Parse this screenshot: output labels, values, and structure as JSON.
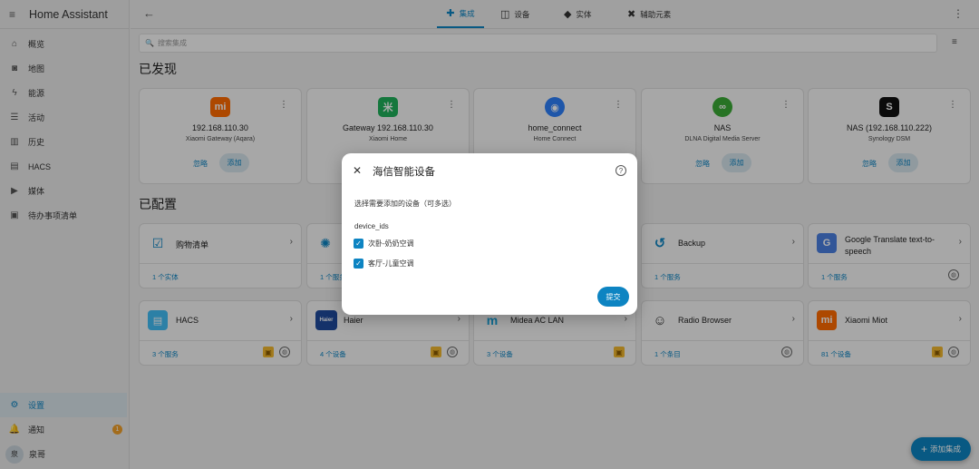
{
  "sidebar": {
    "title": "Home Assistant",
    "items": [
      {
        "label": "概览",
        "icon": "home-icon",
        "glyph": "⌂"
      },
      {
        "label": "地图",
        "icon": "map-icon",
        "glyph": "◙"
      },
      {
        "label": "能源",
        "icon": "lightning-icon",
        "glyph": "ϟ"
      },
      {
        "label": "活动",
        "icon": "list-icon",
        "glyph": "☰"
      },
      {
        "label": "历史",
        "icon": "chart-icon",
        "glyph": "▥"
      },
      {
        "label": "HACS",
        "icon": "hacs-icon",
        "glyph": "▤"
      },
      {
        "label": "媒体",
        "icon": "media-icon",
        "glyph": "▶"
      },
      {
        "label": "待办事项清单",
        "icon": "clipboard-icon",
        "glyph": "▣"
      }
    ],
    "bottom": {
      "settings": "设置",
      "notifications": "通知",
      "notifications_count": "1",
      "user": "泉哥",
      "user_initial": "泉"
    }
  },
  "topbar": {
    "tabs": [
      {
        "label": "集成",
        "glyph": "✚",
        "active": true
      },
      {
        "label": "设备",
        "glyph": "◫",
        "active": false
      },
      {
        "label": "实体",
        "glyph": "◆",
        "active": false
      },
      {
        "label": "辅助元素",
        "glyph": "✖",
        "active": false
      }
    ]
  },
  "search": {
    "placeholder": "搜索集成"
  },
  "discovered": {
    "title": "已发现",
    "ignore_label": "忽略",
    "add_label": "添加",
    "cards": [
      {
        "name": "192.168.110.30",
        "sub": "Xiaomi Gateway (Aqara)",
        "logo": "mi",
        "color": "#ff6a00"
      },
      {
        "name": "Gateway 192.168.110.30",
        "sub": "Xiaomi Home",
        "logo": "米",
        "color": "#20b05a"
      },
      {
        "name": "home_connect",
        "sub": "Home Connect",
        "logo": "◉",
        "color": "#2d7ff9"
      },
      {
        "name": "NAS",
        "sub": "DLNA Digital Media Server",
        "logo": "∞",
        "color": "#3aaa35"
      },
      {
        "name": "NAS (192.168.110.222)",
        "sub": "Synology DSM",
        "logo": "S",
        "color": "#111111"
      }
    ]
  },
  "configured": {
    "title": "已配置",
    "cards": [
      {
        "name": "购物清单",
        "count": "1 个实体",
        "logo": "☑",
        "color": "#f6f6f6",
        "fg": "#0d84c2"
      },
      {
        "name": "",
        "count": "1 个服务",
        "logo": "✺",
        "color": "#f6f6f6",
        "fg": "#0d84c2"
      },
      {
        "name": "",
        "count": "",
        "logo": "",
        "color": "#f6f6f6",
        "fg": "#333"
      },
      {
        "name": "Backup",
        "count": "1 个服务",
        "logo": "↺",
        "color": "#f6f6f6",
        "fg": "#0d84c2"
      },
      {
        "name": "Google Translate text-to-speech",
        "count": "1 个服务",
        "logo": "G",
        "color": "#4a7fe0",
        "fg": "#fff"
      },
      {
        "name": "HACS",
        "count": "3 个服务",
        "logo": "▤",
        "color": "#41bdf5",
        "fg": "#fff"
      },
      {
        "name": "Haier",
        "count": "4 个设备",
        "logo": "Haier",
        "color": "#1f4b9c",
        "fg": "#fff"
      },
      {
        "name": "Midea AC LAN",
        "count": "3 个设备",
        "logo": "m",
        "color": "#f6f6f6",
        "fg": "#1aa3d9"
      },
      {
        "name": "Radio Browser",
        "count": "1 个条目",
        "logo": "☺",
        "color": "#f6f6f6",
        "fg": "#333"
      },
      {
        "name": "Xiaomi Miot",
        "count": "81 个设备",
        "logo": "mi",
        "color": "#ff6a00",
        "fg": "#fff"
      }
    ]
  },
  "dialog": {
    "title": "海信智能设备",
    "description": "选择需要添加的设备（可多选）",
    "field_label": "device_ids",
    "options": [
      {
        "label": "次卧-奶奶空调",
        "checked": true
      },
      {
        "label": "客厅-儿童空调",
        "checked": true
      }
    ],
    "submit": "提交"
  },
  "fab": {
    "label": "添加集成"
  }
}
